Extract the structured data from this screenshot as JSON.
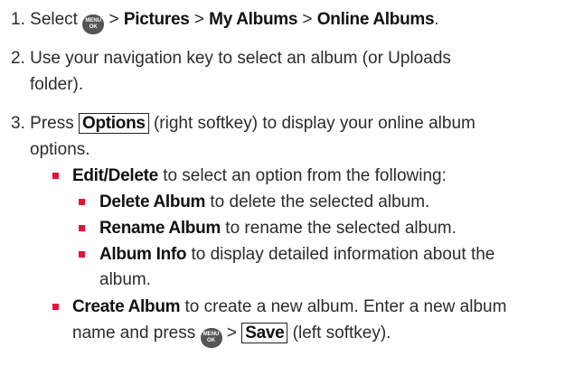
{
  "step1": {
    "num": "1.",
    "text_a": "Select",
    "menu_key_top": "MENU",
    "menu_key_bottom": "OK",
    "sep": ">",
    "pictures": "Pictures",
    "my_albums": "My Albums",
    "online_albums": "Online Albums",
    "end": "."
  },
  "step2": {
    "num": "2.",
    "line1": "Use your navigation key to select an album (or Uploads",
    "line2": "folder)."
  },
  "step3": {
    "num": "3.",
    "text_a": "Press",
    "options": "Options",
    "text_b": "(right softkey) to display your online album",
    "line2": "options."
  },
  "bullets": {
    "edit_delete": {
      "label": "Edit/Delete",
      "text": "to select an option from the following:"
    },
    "delete_album": {
      "label": "Delete Album",
      "text": "to delete the selected album."
    },
    "rename_album": {
      "label": "Rename Album",
      "text": "to rename the selected album."
    },
    "album_info": {
      "label": "Album Info",
      "text": "to display detailed information about the",
      "line2": "album."
    },
    "create_album": {
      "label": "Create Album",
      "text": "to create a new album. Enter a new album",
      "line2_a": "name and press",
      "sep": ">",
      "save": "Save",
      "line2_b": "(left softkey)."
    }
  },
  "colors": {
    "bullet": "#e8123a",
    "text": "#2b2b2b"
  }
}
